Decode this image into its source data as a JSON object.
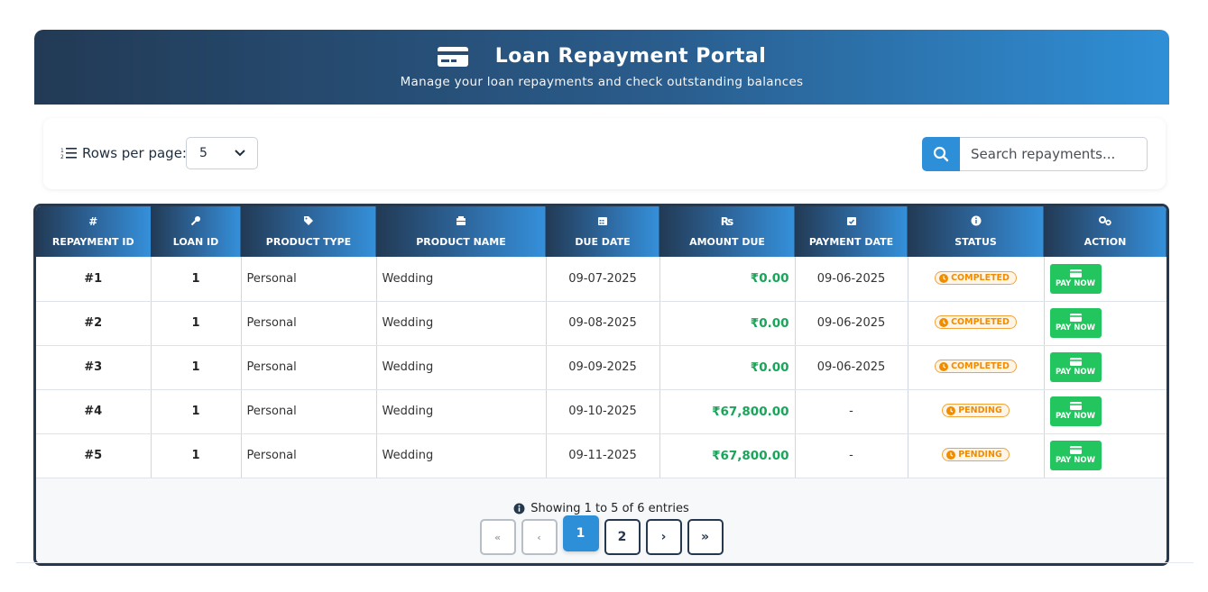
{
  "header": {
    "title": "Loan Repayment Portal",
    "subtitle": "Manage your loan repayments and check outstanding balances",
    "icon": "credit-card-icon"
  },
  "controls": {
    "rows_label": "Rows per page:",
    "rows_value": "5",
    "search_placeholder": "Search repayments..."
  },
  "table": {
    "columns": [
      {
        "label": "REPAYMENT ID",
        "icon": "#"
      },
      {
        "label": "LOAN ID",
        "icon": "key-icon"
      },
      {
        "label": "PRODUCT TYPE",
        "icon": "tag-icon"
      },
      {
        "label": "PRODUCT NAME",
        "icon": "box-icon"
      },
      {
        "label": "DUE DATE",
        "icon": "calendar-icon"
      },
      {
        "label": "AMOUNT DUE",
        "icon": "₨"
      },
      {
        "label": "PAYMENT DATE",
        "icon": "calendar-check-icon"
      },
      {
        "label": "STATUS",
        "icon": "info-icon"
      },
      {
        "label": "ACTION",
        "icon": "gears-icon"
      }
    ],
    "rows": [
      {
        "id": "#1",
        "loan": "1",
        "type": "Personal",
        "name": "Wedding",
        "due": "09-07-2025",
        "amount": "₹0.00",
        "paid": "09-06-2025",
        "status": "COMPLETED",
        "action": "PAY NOW"
      },
      {
        "id": "#2",
        "loan": "1",
        "type": "Personal",
        "name": "Wedding",
        "due": "09-08-2025",
        "amount": "₹0.00",
        "paid": "09-06-2025",
        "status": "COMPLETED",
        "action": "PAY NOW"
      },
      {
        "id": "#3",
        "loan": "1",
        "type": "Personal",
        "name": "Wedding",
        "due": "09-09-2025",
        "amount": "₹0.00",
        "paid": "09-06-2025",
        "status": "COMPLETED",
        "action": "PAY NOW"
      },
      {
        "id": "#4",
        "loan": "1",
        "type": "Personal",
        "name": "Wedding",
        "due": "09-10-2025",
        "amount": "₹67,800.00",
        "paid": "-",
        "status": "PENDING",
        "action": "PAY NOW"
      },
      {
        "id": "#5",
        "loan": "1",
        "type": "Personal",
        "name": "Wedding",
        "due": "09-11-2025",
        "amount": "₹67,800.00",
        "paid": "-",
        "status": "PENDING",
        "action": "PAY NOW"
      }
    ]
  },
  "pagination": {
    "info": "Showing 1 to 5 of 6 entries",
    "first": "«",
    "prev": "‹",
    "pages": [
      "1",
      "2"
    ],
    "next": "›",
    "last": "»",
    "active_page": "1"
  },
  "colors": {
    "header_dark": "#223a55",
    "header_light": "#2f8fd6",
    "amount_green": "#1aa55a",
    "pending_orange": "#f08c00",
    "pay_green": "#22c55e"
  }
}
